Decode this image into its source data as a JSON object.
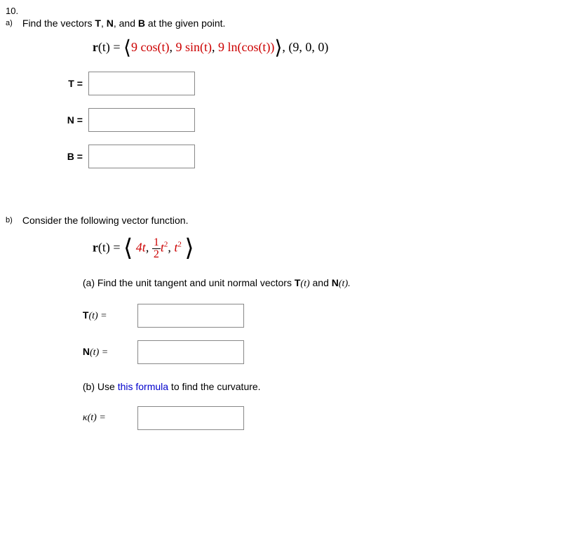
{
  "question_number": "10.",
  "part_a": {
    "label": "a)",
    "prompt_pre": "Find the vectors ",
    "T": "T",
    "comma1": ", ",
    "N": "N",
    "comma2": ", and ",
    "B": "B",
    "prompt_post": " at the given point.",
    "eq_lhs": "r",
    "eq_lhs_arg": "(t) = ",
    "bracket_open": "⟨",
    "c1": "9 cos(t)",
    "sep1": ", ",
    "c2": "9 sin(t)",
    "sep2": ", ",
    "c3": "9 ln(cos(t))",
    "bracket_close": "⟩",
    "point": ",    (9, 0, 0)",
    "answers": {
      "T_label": "T  =",
      "N_label": "N  =",
      "B_label": "B  ="
    }
  },
  "part_b": {
    "label": "b)",
    "prompt": "Consider the following vector function.",
    "eq_lhs": "r",
    "eq_lhs_arg": "(t) = ",
    "bracket_open": "⟨",
    "c1": "4t",
    "sep1": ", ",
    "frac_num": "1",
    "frac_den": "2",
    "c2_var": "t",
    "c2_exp": "2",
    "sep2": ", ",
    "c3_var": "t",
    "c3_exp": "2",
    "bracket_close": "⟩",
    "sub_a_pre": "(a) Find the unit tangent and unit normal vectors ",
    "sub_a_T": "T",
    "sub_a_Targ": "(t)",
    "sub_a_and": " and ",
    "sub_a_N": "N",
    "sub_a_Narg": "(t).",
    "T_label_pre": "T",
    "T_label_post": "(t)  =",
    "N_label_pre": "N",
    "N_label_post": "(t)  =",
    "sub_b_pre": "(b) Use ",
    "sub_b_link": "this formula",
    "sub_b_post": " to find the curvature.",
    "kappa_label_pre": "κ",
    "kappa_label_post": "(t)  ="
  }
}
